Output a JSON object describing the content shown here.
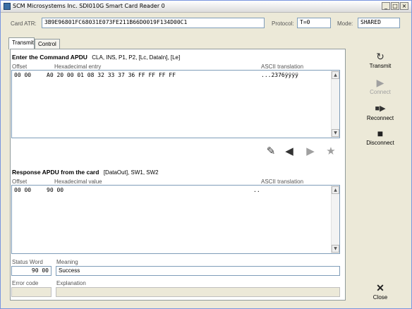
{
  "window": {
    "title": "SCM Microsystems Inc. SDI010G Smart Card Reader 0",
    "minimize": "_",
    "maximize": "□",
    "close": "×"
  },
  "header": {
    "atr_label": "Card ATR:",
    "atr_value": "3B9E96801FC68031E073FE211B66D0019F134D00C1",
    "protocol_label": "Protocol:",
    "protocol_value": "T=0",
    "mode_label": "Mode:",
    "mode_value": "SHARED"
  },
  "tabs": [
    {
      "label": "Transmit"
    },
    {
      "label": "Control"
    }
  ],
  "command": {
    "title": "Enter the Command APDU",
    "subtitle": "CLA, INS, P1, P2, [Lc, DataIn], [Le]",
    "col_offset": "Offset",
    "col_hex": "Hexadecimal entry",
    "col_ascii": "ASCII translation",
    "row_offset": "00 00",
    "row_hex": "A0 20 00 01 08 32 33 37 36 FF FF FF FF",
    "row_ascii": "...2376ÿÿÿÿ"
  },
  "response": {
    "title": "Response APDU from the card",
    "subtitle": "[DataOut], SW1, SW2",
    "col_offset": "Offset",
    "col_hex": "Hexadecimal value",
    "col_ascii": "ASCII translation",
    "row_offset": "00 00",
    "row_hex": "90 00",
    "row_ascii": ".."
  },
  "status": {
    "sw_label": "Status Word",
    "sw_value": "90 00",
    "meaning_label": "Meaning",
    "meaning_value": "Success",
    "error_label": "Error code",
    "error_value": "",
    "explanation_label": "Explanation",
    "explanation_value": ""
  },
  "sidebar": {
    "transmit": "Transmit",
    "connect": "Connect",
    "reconnect": "Reconnect",
    "disconnect": "Disconnect",
    "close": "Close"
  },
  "icons": {
    "transmit": "refresh-icon",
    "connect": "play-icon",
    "reconnect": "stop-play-icon",
    "disconnect": "stop-icon",
    "close": "close-x-icon",
    "eraser": "eraser-icon",
    "back": "arrow-left-icon",
    "forward": "arrow-right-icon",
    "favorite": "star-icon"
  },
  "colors": {
    "accent": "#3a6ea5",
    "disabled": "#a0a0a0"
  }
}
